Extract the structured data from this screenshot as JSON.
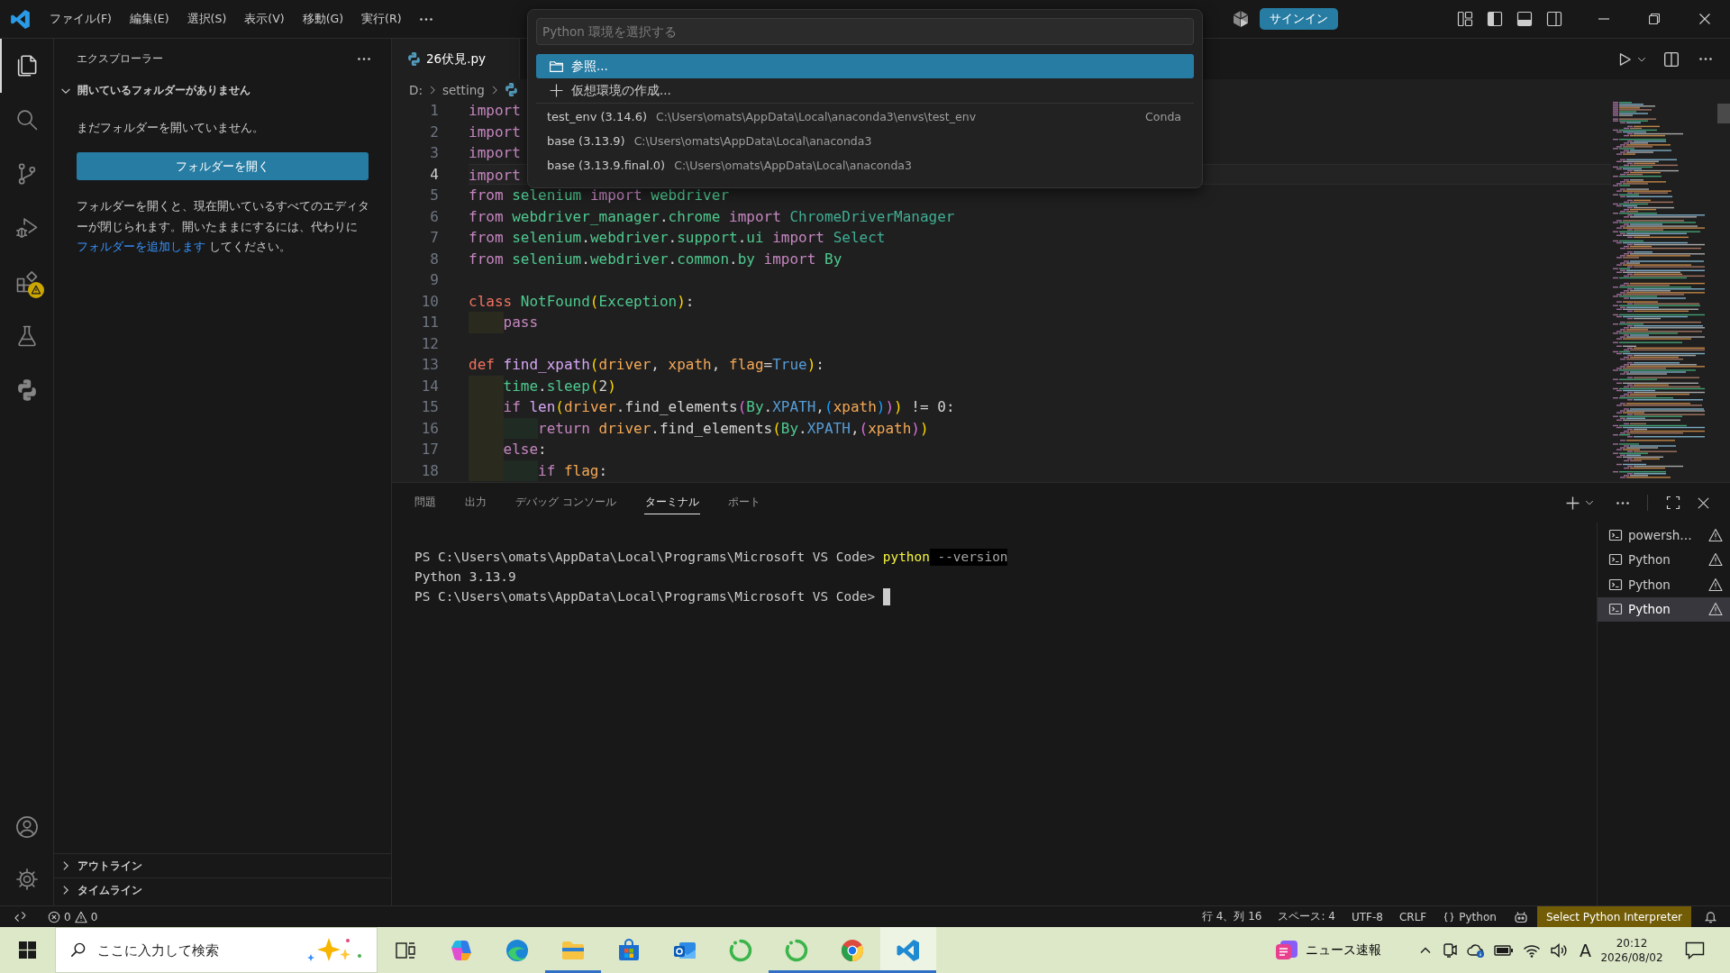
{
  "title_bar": {
    "menus": [
      "ファイル(F)",
      "編集(E)",
      "選択(S)",
      "表示(V)",
      "移動(G)",
      "実行(R)"
    ],
    "sign_in": "サインイン"
  },
  "activity_bar": {
    "items": [
      {
        "kind": "explorer",
        "selected": true,
        "warning": false
      },
      {
        "kind": "search",
        "selected": false,
        "warning": false
      },
      {
        "kind": "source_control",
        "selected": false,
        "warning": false
      },
      {
        "kind": "run_debug",
        "selected": false,
        "warning": false
      },
      {
        "kind": "extensions",
        "selected": false,
        "warning": true
      },
      {
        "kind": "testing",
        "selected": false,
        "warning": false
      },
      {
        "kind": "python",
        "selected": false,
        "warning": false
      }
    ]
  },
  "sidebar": {
    "title": "エクスプローラー",
    "section": {
      "title": "開いているフォルダーがありません",
      "expanded": true
    },
    "message": "まだフォルダーを開いていません。",
    "open_button": "フォルダーを開く",
    "note": {
      "before": "フォルダーを開くと、現在開いているすべてのエディターが閉じられます。開いたままにするには、代わりに",
      "link": "フォルダーを追加します",
      "after": "してください。"
    },
    "bottom_sections": [
      {
        "title": "アウトライン",
        "expanded": false
      },
      {
        "title": "タイムライン",
        "expanded": false
      }
    ]
  },
  "quick_pick": {
    "placeholder": "Python 環境を選択する",
    "items": [
      {
        "kind": "browse",
        "label": "参照...",
        "selected": true
      },
      {
        "kind": "create",
        "label": "仮想環境の作成...",
        "selected": false
      },
      {
        "kind": "env",
        "label": "test_env (3.14.6)",
        "path": "C:\\Users\\omats\\AppData\\Local\\anaconda3\\envs\\test_env",
        "detail": "Conda",
        "selected": false
      },
      {
        "kind": "env",
        "label": "base (3.13.9)",
        "path": "C:\\Users\\omats\\AppData\\Local\\anaconda3",
        "selected": false
      },
      {
        "kind": "env",
        "label": "base (3.13.9.final.0)",
        "path": "C:\\Users\\omats\\AppData\\Local\\anaconda3",
        "selected": false
      }
    ]
  },
  "editor": {
    "tabs": [
      {
        "label": "26伏見.py",
        "selected": true
      }
    ],
    "breadcrumbs": [
      "D:",
      "setting"
    ],
    "lines": [
      {
        "number": "1",
        "current": false,
        "tokens": [
          {
            "kind": "keyword",
            "text": "import"
          }
        ]
      },
      {
        "number": "2",
        "current": false,
        "tokens": [
          {
            "kind": "keyword",
            "text": "import"
          }
        ]
      },
      {
        "number": "3",
        "current": false,
        "tokens": [
          {
            "kind": "keyword",
            "text": "import"
          }
        ]
      },
      {
        "number": "4",
        "current": true,
        "tokens": [
          {
            "kind": "keyword",
            "text": "import"
          }
        ]
      },
      {
        "number": "5",
        "current": false,
        "tokens": [
          {
            "kind": "keyword",
            "text": "from "
          },
          {
            "kind": "module",
            "text": "selenium "
          },
          {
            "kind": "keyword",
            "text": "import "
          },
          {
            "kind": "module",
            "text": "webdriver"
          }
        ]
      },
      {
        "number": "6",
        "current": false,
        "tokens": [
          {
            "kind": "keyword",
            "text": "from "
          },
          {
            "kind": "module",
            "text": "webdriver_manager"
          },
          {
            "kind": "plain",
            "text": "."
          },
          {
            "kind": "module",
            "text": "chrome "
          },
          {
            "kind": "keyword",
            "text": "import "
          },
          {
            "kind": "class",
            "text": "ChromeDriverManager"
          }
        ]
      },
      {
        "number": "7",
        "current": false,
        "tokens": [
          {
            "kind": "keyword",
            "text": "from "
          },
          {
            "kind": "module",
            "text": "selenium"
          },
          {
            "kind": "plain",
            "text": "."
          },
          {
            "kind": "module",
            "text": "webdriver"
          },
          {
            "kind": "plain",
            "text": "."
          },
          {
            "kind": "module",
            "text": "support"
          },
          {
            "kind": "plain",
            "text": "."
          },
          {
            "kind": "module",
            "text": "ui "
          },
          {
            "kind": "keyword",
            "text": "import "
          },
          {
            "kind": "class",
            "text": "Select"
          }
        ]
      },
      {
        "number": "8",
        "current": false,
        "tokens": [
          {
            "kind": "keyword",
            "text": "from "
          },
          {
            "kind": "module",
            "text": "selenium"
          },
          {
            "kind": "plain",
            "text": "."
          },
          {
            "kind": "module",
            "text": "webdriver"
          },
          {
            "kind": "plain",
            "text": "."
          },
          {
            "kind": "module",
            "text": "common"
          },
          {
            "kind": "plain",
            "text": "."
          },
          {
            "kind": "module",
            "text": "by "
          },
          {
            "kind": "keyword",
            "text": "import "
          },
          {
            "kind": "module",
            "text": "By"
          }
        ]
      },
      {
        "number": "9",
        "current": false
      },
      {
        "number": "10",
        "current": false,
        "tokens": [
          {
            "kind": "storage",
            "text": "class "
          },
          {
            "kind": "module",
            "text": "NotFound"
          },
          {
            "kind": "b1",
            "text": "("
          },
          {
            "kind": "module",
            "text": "Exception"
          },
          {
            "kind": "b1",
            "text": ")"
          },
          {
            "kind": "plain",
            "text": ":"
          }
        ]
      },
      {
        "number": "11",
        "current": false,
        "indents": [
          {
            "color": "#2a2a1e"
          }
        ],
        "tokens": [
          {
            "kind": "keyword",
            "text": "pass"
          }
        ]
      },
      {
        "number": "12",
        "current": false
      },
      {
        "number": "13",
        "current": false,
        "tokens": [
          {
            "kind": "storage",
            "text": "def "
          },
          {
            "kind": "func",
            "text": "find_xpath"
          },
          {
            "kind": "b1",
            "text": "("
          },
          {
            "kind": "param",
            "text": "driver"
          },
          {
            "kind": "plain",
            "text": ", "
          },
          {
            "kind": "param",
            "text": "xpath"
          },
          {
            "kind": "plain",
            "text": ", "
          },
          {
            "kind": "param",
            "text": "flag"
          },
          {
            "kind": "plain",
            "text": "="
          },
          {
            "kind": "constant",
            "text": "True"
          },
          {
            "kind": "b1",
            "text": ")"
          },
          {
            "kind": "plain",
            "text": ":"
          }
        ]
      },
      {
        "number": "14",
        "current": false,
        "indents": [
          {
            "color": "#2a2a1e"
          }
        ],
        "tokens": [
          {
            "kind": "module",
            "text": "time"
          },
          {
            "kind": "plain",
            "text": "."
          },
          {
            "kind": "module",
            "text": "sleep"
          },
          {
            "kind": "b1",
            "text": "("
          },
          {
            "kind": "plain",
            "text": "2"
          },
          {
            "kind": "b1",
            "text": ")"
          }
        ]
      },
      {
        "number": "15",
        "current": false,
        "indents": [
          {
            "color": "#2a2a1e"
          }
        ],
        "tokens": [
          {
            "kind": "keyword",
            "text": "if "
          },
          {
            "kind": "func",
            "text": "len"
          },
          {
            "kind": "b1",
            "text": "("
          },
          {
            "kind": "param",
            "text": "driver"
          },
          {
            "kind": "plain",
            "text": ".find_elements"
          },
          {
            "kind": "b2",
            "text": "("
          },
          {
            "kind": "module",
            "text": "By"
          },
          {
            "kind": "plain",
            "text": "."
          },
          {
            "kind": "constant",
            "text": "XPATH"
          },
          {
            "kind": "plain",
            "text": ","
          },
          {
            "kind": "b3",
            "text": "("
          },
          {
            "kind": "param",
            "text": "xpath"
          },
          {
            "kind": "b3",
            "text": ")"
          },
          {
            "kind": "b2",
            "text": ")"
          },
          {
            "kind": "b1",
            "text": ")"
          },
          {
            "kind": "plain",
            "text": " != 0:"
          }
        ]
      },
      {
        "number": "16",
        "current": false,
        "indents": [
          {
            "color": "#2a2a1e"
          },
          {
            "color": "#1f2b23"
          }
        ],
        "tokens": [
          {
            "kind": "keyword",
            "text": "return "
          },
          {
            "kind": "param",
            "text": "driver"
          },
          {
            "kind": "plain",
            "text": ".find_elements"
          },
          {
            "kind": "b1",
            "text": "("
          },
          {
            "kind": "module",
            "text": "By"
          },
          {
            "kind": "plain",
            "text": "."
          },
          {
            "kind": "constant",
            "text": "XPATH"
          },
          {
            "kind": "plain",
            "text": ","
          },
          {
            "kind": "b2",
            "text": "("
          },
          {
            "kind": "param",
            "text": "xpath"
          },
          {
            "kind": "b2",
            "text": ")"
          },
          {
            "kind": "b1",
            "text": ")"
          }
        ]
      },
      {
        "number": "17",
        "current": false,
        "indents": [
          {
            "color": "#2a2a1e"
          }
        ],
        "tokens": [
          {
            "kind": "keyword",
            "text": "else"
          },
          {
            "kind": "plain",
            "text": ":"
          }
        ]
      },
      {
        "number": "18",
        "current": false,
        "indents": [
          {
            "color": "#2a2a1e"
          },
          {
            "color": "#1f2b23"
          }
        ],
        "tokens": [
          {
            "kind": "keyword",
            "text": "if "
          },
          {
            "kind": "param",
            "text": "flag"
          },
          {
            "kind": "plain",
            "text": ":"
          }
        ]
      }
    ]
  },
  "panel": {
    "tabs": [
      {
        "label": "問題",
        "selected": false
      },
      {
        "label": "出力",
        "selected": false
      },
      {
        "label": "デバッグ コンソール",
        "selected": false
      },
      {
        "label": "ターミナル",
        "selected": true
      },
      {
        "label": "ポート",
        "selected": false
      }
    ],
    "terminal": {
      "lines": [
        {
          "segments": [
            {
              "kind": "plain",
              "text": "PS C:\\Users\\omats\\AppData\\Local\\Programs\\Microsoft VS Code> "
            },
            {
              "kind": "command",
              "text": "python"
            },
            {
              "kind": "ghost",
              "text": " --version"
            }
          ],
          "cursor": false
        },
        {
          "segments": [
            {
              "kind": "plain",
              "text": "Python 3.13.9"
            }
          ],
          "cursor": false
        },
        {
          "segments": [
            {
              "kind": "plain",
              "text": "PS C:\\Users\\omats\\AppData\\Local\\Programs\\Microsoft VS Code> "
            }
          ],
          "cursor": true
        }
      ],
      "sessions": [
        {
          "label": "powersh…",
          "selected": false,
          "warning": true
        },
        {
          "label": "Python",
          "selected": false,
          "warning": true
        },
        {
          "label": "Python",
          "selected": false,
          "warning": true
        },
        {
          "label": "Python",
          "selected": true,
          "warning": true
        }
      ]
    }
  },
  "status_bar": {
    "errors": "0",
    "warnings": "0",
    "items": [
      "行 4、列 16",
      "スペース: 4",
      "UTF-8",
      "CRLF"
    ],
    "language": "Python",
    "interpreter": "Select Python Interpreter"
  },
  "taskbar": {
    "search": {
      "placeholder": "ここに入力して検索"
    },
    "apps": [
      {
        "kind": "copilot",
        "running": false,
        "active": false
      },
      {
        "kind": "edge",
        "running": false,
        "active": false
      },
      {
        "kind": "explorer",
        "running": true,
        "active": false
      },
      {
        "kind": "store",
        "running": false,
        "active": false
      },
      {
        "kind": "outlook",
        "running": false,
        "active": false
      },
      {
        "kind": "ring_app",
        "running": false,
        "active": false
      },
      {
        "kind": "ring_app",
        "running": true,
        "active": false
      },
      {
        "kind": "chrome",
        "running": true,
        "active": false
      },
      {
        "kind": "vscode",
        "running": true,
        "active": true
      }
    ],
    "news": "ニュース速報",
    "ime": "A",
    "time": "20:12",
    "date": "2026/08/02"
  }
}
